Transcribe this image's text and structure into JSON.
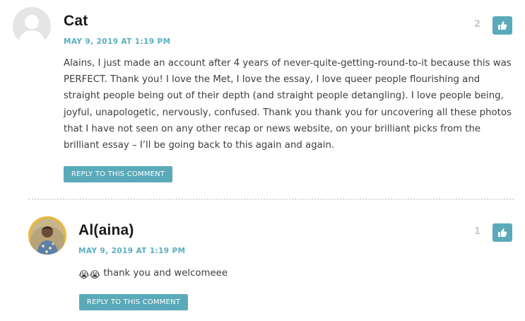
{
  "comments": [
    {
      "author": "Cat",
      "date": "MAY 9, 2019 AT 1:19 PM",
      "votes": "2",
      "text": "Alains, I just made an account after 4 years of never-quite-getting-round-to-it because this was PERFECT. Thank you! I love the Met, I love the essay, I love queer people flourishing and straight people being out of their depth (and straight people detangling). I love people being, joyful, unapologetic, nervously, confused. Thank you thank you for uncovering all these photos that I have not seen on any other recap or news website, on your brilliant picks from the brilliant essay – I’ll be going back to this again and again.",
      "reply_label": "REPLY TO THIS COMMENT",
      "avatar_icon": "default-avatar-icon",
      "vote_icon": "thumbs-up-icon"
    },
    {
      "author": "Al(aina)",
      "date": "MAY 9, 2019 AT 1:19 PM",
      "votes": "1",
      "emoji": "😭😭",
      "text": "thank you and welcomeee",
      "reply_label": "REPLY TO THIS COMMENT",
      "avatar_icon": "user-photo-avatar",
      "vote_icon": "thumbs-up-icon"
    }
  ],
  "colors": {
    "accent": "#5aaab9",
    "date": "#5aafc0",
    "avatar_ring": "#e8b93a"
  }
}
